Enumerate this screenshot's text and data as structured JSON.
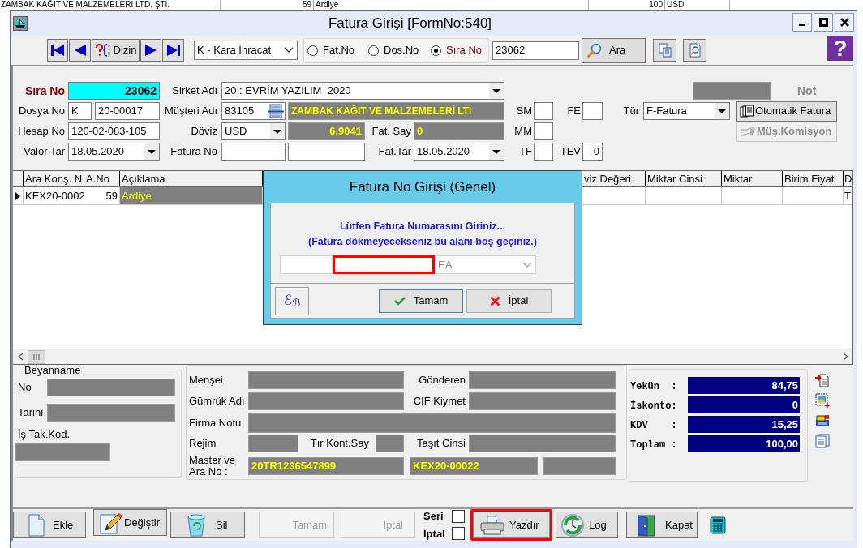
{
  "background_table": {
    "row": [
      "ZAMBAK KAĞIT VE MALZEMELERİ LTD. ŞTİ.",
      "59",
      "Ardiye",
      "100",
      "USD"
    ]
  },
  "window": {
    "title": "Fatura Girişi [FormNo:540]"
  },
  "toolbar": {
    "index_button": {
      "label": "Dizin"
    },
    "type_select": {
      "value": "K - Kara İhracat"
    },
    "search_by": [
      {
        "label": "Fat.No",
        "selected": false
      },
      {
        "label": "Dos.No",
        "selected": false
      },
      {
        "label": "Sıra No",
        "selected": true
      }
    ],
    "search_field": {
      "value": "23062"
    },
    "search_button": {
      "label": "Ara"
    },
    "help_button": {
      "label": "?"
    }
  },
  "form": {
    "sira_no": {
      "label": "Sıra No",
      "value": "23062"
    },
    "sirket_adi": {
      "label": "Sirket Adı",
      "value": "20 : EVRİM YAZILIM  2020"
    },
    "not": {
      "label": "Not"
    },
    "dosya_no": {
      "label": "Dosya No",
      "prefix": "K",
      "value": "20-00017"
    },
    "musteri_adi": {
      "label": "Müşteri Adı",
      "code": "83105",
      "name": "ZAMBAK KAĞIT VE MALZEMELERİ LTI"
    },
    "sm": {
      "label": "SM"
    },
    "fe": {
      "label": "FE"
    },
    "tur": {
      "label": "Tür",
      "value": "F-Fatura"
    },
    "hesap_no": {
      "label": "Hesap No",
      "value": "120-02-083-105"
    },
    "doviz": {
      "label": "Döviz",
      "value": "USD",
      "rate": "6,9041"
    },
    "fat_say": {
      "label": "Fat. Say",
      "value": "0"
    },
    "mm": {
      "label": "MM"
    },
    "valor_tar": {
      "label": "Valor Tar",
      "value": "18.05.2020"
    },
    "fatura_no": {
      "label": "Fatura No"
    },
    "fat_tar": {
      "label": "Fat.Tar",
      "value": "18.05.2020"
    },
    "tf": {
      "label": "TF"
    },
    "tev": {
      "label": "TEV",
      "value": "0"
    },
    "side_buttons": [
      {
        "kind": "invoice",
        "label": "Otomatik Fatura",
        "disabled": false
      },
      {
        "kind": "commission",
        "label": "Müş.Komisyon",
        "disabled": true
      }
    ]
  },
  "grid": {
    "columns": [
      "Ara Konş. N",
      "A.No",
      "Açıklama",
      "viz Değeri",
      "Miktar Cinsi",
      "Miktar",
      "Birim Fiyat",
      "D"
    ],
    "rows": [
      {
        "selected": true,
        "cells": [
          {
            "text": "KEX20-0002",
            "selected": false
          },
          {
            "text": "59",
            "selected": false
          },
          {
            "text": "Ardiye",
            "selected": true
          },
          {
            "selected": false
          },
          {
            "selected": false
          },
          {
            "selected": false
          },
          {
            "selected": false
          },
          {
            "text": "T",
            "selected": false
          }
        ]
      }
    ]
  },
  "beyanname": {
    "title": "Beyanname",
    "no": {
      "label": "No"
    },
    "tarihi": {
      "label": "Tarihi"
    },
    "is_tak_kod": {
      "label": "İş Tak.Kod."
    }
  },
  "details": {
    "mensei": {
      "label": "Menşei"
    },
    "gonderen": {
      "label": "Gönderen"
    },
    "gumruk_adi": {
      "label": "Gümrük Adı"
    },
    "cif_kiymet": {
      "label": "CIF Kiymet"
    },
    "firma_notu": {
      "label": "Firma Notu"
    },
    "rejim": {
      "label": "Rejim"
    },
    "tir_kont_say": {
      "label": "Tır Kont.Say"
    },
    "tasit_cinsi": {
      "label": "Taşıt Cinsi"
    },
    "master_ara_no": {
      "label": "Master ve Ara No :",
      "master": "20TR1236547899",
      "ara_no": "KEX20-00022"
    }
  },
  "totals": [
    {
      "label": "Yekün  :",
      "value": "84,75"
    },
    {
      "label": "İskonto:",
      "value": "0"
    },
    {
      "label": "KDV    :",
      "value": "15,25"
    },
    {
      "label": "Toplam :",
      "value": "100,00"
    }
  ],
  "actions": [
    {
      "kind": "add",
      "label": "Ekle",
      "disabled": false
    },
    {
      "kind": "edit",
      "label": "Değiştir",
      "disabled": false
    },
    {
      "kind": "delete",
      "label": "Sil",
      "disabled": false
    },
    {
      "kind": "ok",
      "label": "Tamam",
      "disabled": true
    },
    {
      "kind": "cancel",
      "label": "İptal",
      "disabled": true
    }
  ],
  "print_options": [
    {
      "label": "Seri",
      "checked": false
    },
    {
      "label": "İptal",
      "checked": false
    }
  ],
  "output_actions": [
    {
      "kind": "print",
      "label": "Yazdır",
      "highlighted": true
    },
    {
      "kind": "log",
      "label": "Log",
      "highlighted": false
    },
    {
      "kind": "close",
      "label": "Kapat",
      "highlighted": false
    }
  ],
  "dialog": {
    "title": "Fatura No Girişi (Genel)",
    "message": [
      "Lütfen Fatura Numarasını Giriniz...",
      "(Fatura dökmeyecekseniz bu alanı boş geçiniz.)"
    ],
    "fields": [
      {
        "highlighted": false
      },
      {
        "highlighted": true
      }
    ],
    "series_select": {
      "value": "EA"
    },
    "logo_button": {
      "label": "ℰ$_{ℬ}$"
    },
    "buttons": [
      {
        "kind": "ok",
        "label": "Tamam",
        "focused": true
      },
      {
        "kind": "cancel",
        "label": "İptal",
        "focused": false
      }
    ]
  }
}
